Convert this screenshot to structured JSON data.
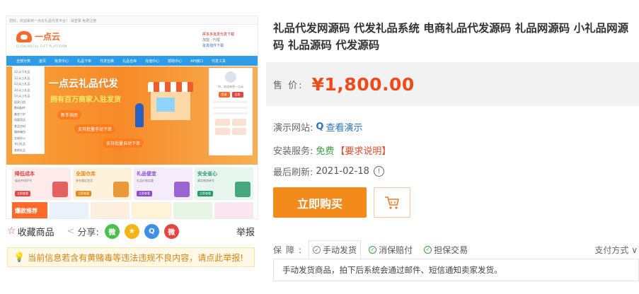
{
  "preview": {
    "topbar_text": "您好，欢迎来到一点云礼品代发平台！ 请登录 免费注册",
    "logo_text": "一点云",
    "logo_sub": "ECONOMICAL GIFT PLATFORM",
    "promo": [
      "拼多多批发代发下载",
      "加盟 · 代理",
      "批发插件下载"
    ],
    "nav": [
      "全部分类",
      "首页",
      "批发中心",
      "礼品下单",
      "代发包裹",
      "礼品仓库",
      "充值中心",
      "帮助中心",
      "API接口",
      "代发工具"
    ],
    "categories": [
      "1元以下礼品",
      "1元以上礼品",
      "2元以上礼品",
      "3元以上礼品",
      "5元以上礼品",
      "居家日用",
      "数码配件",
      "美妆个护",
      "母婴用品",
      "食品饮料",
      "服饰箱包",
      "文体办公",
      "节日礼品",
      "其他礼品"
    ],
    "banner_title": "一点云礼品代发",
    "banner_sub": "拥有百万商家入驻发货",
    "banner_chips": [
      "新手指南",
      "支持批量手动下单",
      "支持批量自动下单"
    ],
    "user_panel": {
      "greeting": "Hi，欢迎来到一点云",
      "login": "登录",
      "register": "注册"
    },
    "cards": [
      {
        "title": "降低成本",
        "sub": "省去中间环节",
        "btn": "立即查看",
        "color": "#e04848",
        "bg": "#fdeaea"
      },
      {
        "title": "全国仓库",
        "sub": "多仓就近发货",
        "btn": "立即查看",
        "color": "#e58a1a",
        "bg": "#fff2dd"
      },
      {
        "title": "礼品便宜",
        "sub": "礼品价格实惠",
        "btn": "立即查看",
        "color": "#8a4cc9",
        "bg": "#f4ebfb"
      },
      {
        "title": "安全省心",
        "sub": "真实物流单号",
        "btn": "立即查看",
        "color": "#2a9a6a",
        "bg": "#e6f6ef"
      }
    ],
    "hot_label": "爆款推荐"
  },
  "share": {
    "favorite": "收藏商品",
    "share_label": "分享:",
    "report": "举报",
    "socials": [
      {
        "name": "wechat-icon",
        "glyph": "微",
        "color": "#4cbf4c"
      },
      {
        "name": "qzone-icon",
        "glyph": "★",
        "color": "#f2b417"
      },
      {
        "name": "qq-icon",
        "glyph": "Q",
        "color": "#3f8fe8"
      },
      {
        "name": "weibo-icon",
        "glyph": "微",
        "color": "#e6443f"
      }
    ]
  },
  "warning": "当前信息若含有黄赌毒等违法违规不良内容，请点此举报!",
  "product": {
    "title": "礼品代发网源码 代发礼品系统 电商礼品代发源码 礼品网源码 小礼品网源码 礼品源码 代发源码",
    "price_label": "售 价:",
    "price": "¥1,800.00",
    "demo_label": "演示网站:",
    "demo_link": "查看演示",
    "install_label": "安装服务:",
    "install_value": "免费",
    "install_req": "【要求说明】",
    "refresh_label": "最后刷新:",
    "refresh_date": "2021-02-18",
    "buy_button": "立即购买"
  },
  "guarantee": {
    "label": "保障:",
    "tags": [
      "手动发货",
      "消保赔付",
      "担保交易"
    ],
    "pay_mode": "支付方式",
    "description": "手动发货商品，拍下后系统会通过邮件、短信通知卖家发货。"
  }
}
